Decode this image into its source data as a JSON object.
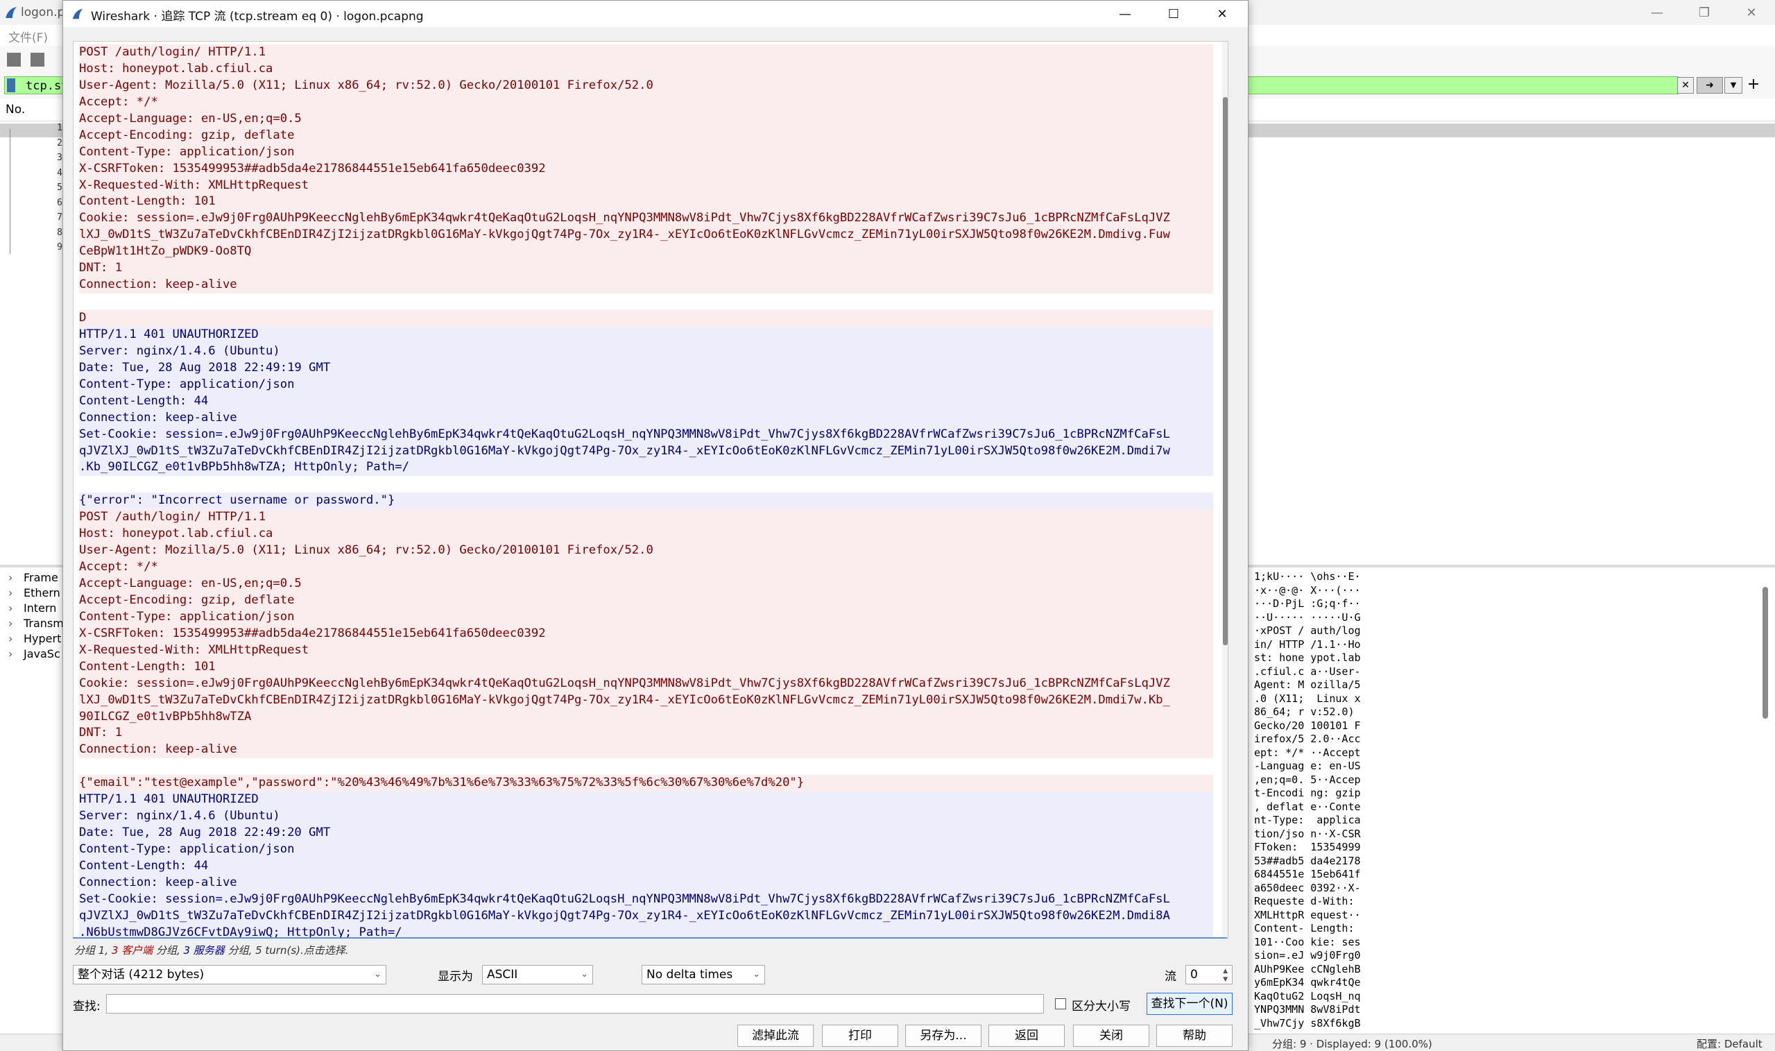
{
  "background_window": {
    "title": "logon.p",
    "menu": "文件(F)",
    "filter_value": "tcp.str",
    "column_no": "No.",
    "packet_numbers": [
      "1",
      "2",
      "3",
      "4",
      "5",
      "6",
      "7",
      "8",
      "9"
    ],
    "details": [
      "Frame",
      "Ethern",
      "Intern",
      "Transm",
      "Hypert",
      "JavaSc"
    ],
    "hex_lines": [
      "1;kU···· \\ohs··E·",
      "·x··@·@· X···(···",
      "···D·PjL :G;q·f··",
      "··U····· ·····U·G",
      "·xPOST / auth/log",
      "in/ HTTP /1.1··Ho",
      "st: hone ypot.lab",
      ".cfiul.c a··User-",
      "Agent: M ozilla/5",
      ".0 (X11;  Linux x",
      "86_64; r v:52.0)",
      "Gecko/20 100101 F",
      "irefox/5 2.0··Acc",
      "ept: */* ··Accept",
      "-Languag e: en-US",
      ",en;q=0. 5··Accep",
      "t-Encodi ng: gzip",
      ", deflat e··Conte",
      "nt-Type:  applica",
      "tion/jso n··X-CSR",
      "FToken:  15354999",
      "53##adb5 da4e2178",
      "6844551e 15eb641f",
      "a650deec 0392··X-",
      "Requeste d-With:",
      "XMLHttpR equest··",
      "Content- Length:",
      "101··Coo kie: ses",
      "sion=.eJ w9j0Frg0",
      "AUhP9Kee cCNglehB",
      "y6mEpK34 qwkr4tQe",
      "KaqOtuG2 LoqsH_nq",
      "YNPQ3MMN 8wV8iPdt",
      "_Vhw7Cjy s8Xf6kgB"
    ],
    "status_left": "分组: 9 · Displayed: 9 (100.0%)",
    "status_right": "配置: Default"
  },
  "dialog": {
    "title": "Wireshark · 追踪 TCP 流 (tcp.stream eq 0) · logon.pcapng",
    "stream_lines": [
      {
        "t": "POST /auth/login/ HTTP/1.1",
        "s": "cli"
      },
      {
        "t": "Host: honeypot.lab.cfiul.ca",
        "s": "cli"
      },
      {
        "t": "User-Agent: Mozilla/5.0 (X11; Linux x86_64; rv:52.0) Gecko/20100101 Firefox/52.0",
        "s": "cli"
      },
      {
        "t": "Accept: */*",
        "s": "cli"
      },
      {
        "t": "Accept-Language: en-US,en;q=0.5",
        "s": "cli"
      },
      {
        "t": "Accept-Encoding: gzip, deflate",
        "s": "cli"
      },
      {
        "t": "Content-Type: application/json",
        "s": "cli"
      },
      {
        "t": "X-CSRFToken: 1535499953##adb5da4e21786844551e15eb641fa650deec0392",
        "s": "cli"
      },
      {
        "t": "X-Requested-With: XMLHttpRequest",
        "s": "cli"
      },
      {
        "t": "Content-Length: 101",
        "s": "cli"
      },
      {
        "t": "Cookie: session=.eJw9j0Frg0AUhP9KeeccNglehBy6mEpK34qwkr4tQeKaqOtuG2LoqsH_nqYNPQ3MMN8wV8iPdt_Vhw7Cjys8Xf6kgBD228AVfrWCafZwsri39C7sJu6_1cBPRcNZMfCaFsLqJVZ",
        "s": "cli"
      },
      {
        "t": "lXJ_0wD1tS_tW3Zu7aTeDvCkhfCBEnDIR4ZjI2ijzatDRgkbl0G16MaY-kVkgojQgt74Pg-7Ox_zy1R4-_xEYIcOo6tEoK0zKlNFLGvVcmcz_ZEMin71yL00irSXJW5Qto98f0w26KE2M.Dmdivg.Fuw",
        "s": "cli"
      },
      {
        "t": "CeBpW1t1HtZo_pWDK9-Oo8TQ",
        "s": "cli"
      },
      {
        "t": "DNT: 1",
        "s": "cli"
      },
      {
        "t": "Connection: keep-alive",
        "s": "cli"
      },
      {
        "t": "",
        "s": "blank"
      },
      {
        "t": "D",
        "s": "cli"
      },
      {
        "t": "HTTP/1.1 401 UNAUTHORIZED",
        "s": "srv"
      },
      {
        "t": "Server: nginx/1.4.6 (Ubuntu)",
        "s": "srv"
      },
      {
        "t": "Date: Tue, 28 Aug 2018 22:49:19 GMT",
        "s": "srv"
      },
      {
        "t": "Content-Type: application/json",
        "s": "srv"
      },
      {
        "t": "Content-Length: 44",
        "s": "srv"
      },
      {
        "t": "Connection: keep-alive",
        "s": "srv"
      },
      {
        "t": "Set-Cookie: session=.eJw9j0Frg0AUhP9KeeccNglehBy6mEpK34qwkr4tQeKaqOtuG2LoqsH_nqYNPQ3MMN8wV8iPdt_Vhw7Cjys8Xf6kgBD228AVfrWCafZwsri39C7sJu6_1cBPRcNZMfCaFsL",
        "s": "srv"
      },
      {
        "t": "qJVZlXJ_0wD1tS_tW3Zu7aTeDvCkhfCBEnDIR4ZjI2ijzatDRgkbl0G16MaY-kVkgojQgt74Pg-7Ox_zy1R4-_xEYIcOo6tEoK0zKlNFLGvVcmcz_ZEMin71yL00irSXJW5Qto98f0w26KE2M.Dmdi7w",
        "s": "srv"
      },
      {
        "t": ".Kb_90ILCGZ_e0t1vBPb5hh8wTZA; HttpOnly; Path=/",
        "s": "srv"
      },
      {
        "t": "",
        "s": "blank"
      },
      {
        "t": "{\"error\": \"Incorrect username or password.\"}",
        "s": "srv"
      },
      {
        "t": "POST /auth/login/ HTTP/1.1",
        "s": "cli"
      },
      {
        "t": "Host: honeypot.lab.cfiul.ca",
        "s": "cli"
      },
      {
        "t": "User-Agent: Mozilla/5.0 (X11; Linux x86_64; rv:52.0) Gecko/20100101 Firefox/52.0",
        "s": "cli"
      },
      {
        "t": "Accept: */*",
        "s": "cli"
      },
      {
        "t": "Accept-Language: en-US,en;q=0.5",
        "s": "cli"
      },
      {
        "t": "Accept-Encoding: gzip, deflate",
        "s": "cli"
      },
      {
        "t": "Content-Type: application/json",
        "s": "cli"
      },
      {
        "t": "X-CSRFToken: 1535499953##adb5da4e21786844551e15eb641fa650deec0392",
        "s": "cli"
      },
      {
        "t": "X-Requested-With: XMLHttpRequest",
        "s": "cli"
      },
      {
        "t": "Content-Length: 101",
        "s": "cli"
      },
      {
        "t": "Cookie: session=.eJw9j0Frg0AUhP9KeeccNglehBy6mEpK34qwkr4tQeKaqOtuG2LoqsH_nqYNPQ3MMN8wV8iPdt_Vhw7Cjys8Xf6kgBD228AVfrWCafZwsri39C7sJu6_1cBPRcNZMfCaFsLqJVZ",
        "s": "cli"
      },
      {
        "t": "lXJ_0wD1tS_tW3Zu7aTeDvCkhfCBEnDIR4ZjI2ijzatDRgkbl0G16MaY-kVkgojQgt74Pg-7Ox_zy1R4-_xEYIcOo6tEoK0zKlNFLGvVcmcz_ZEMin71yL00irSXJW5Qto98f0w26KE2M.Dmdi7w.Kb_",
        "s": "cli"
      },
      {
        "t": "90ILCGZ_e0t1vBPb5hh8wTZA",
        "s": "cli"
      },
      {
        "t": "DNT: 1",
        "s": "cli"
      },
      {
        "t": "Connection: keep-alive",
        "s": "cli"
      },
      {
        "t": "",
        "s": "blank"
      },
      {
        "t": "{\"email\":\"test@example\",\"password\":\"%20%43%46%49%7b%31%6e%73%33%63%75%72%33%5f%6c%30%67%30%6e%7d%20\"}",
        "s": "cli"
      },
      {
        "t": "HTTP/1.1 401 UNAUTHORIZED",
        "s": "srv"
      },
      {
        "t": "Server: nginx/1.4.6 (Ubuntu)",
        "s": "srv"
      },
      {
        "t": "Date: Tue, 28 Aug 2018 22:49:20 GMT",
        "s": "srv"
      },
      {
        "t": "Content-Type: application/json",
        "s": "srv"
      },
      {
        "t": "Content-Length: 44",
        "s": "srv"
      },
      {
        "t": "Connection: keep-alive",
        "s": "srv"
      },
      {
        "t": "Set-Cookie: session=.eJw9j0Frg0AUhP9KeeccNglehBy6mEpK34qwkr4tQeKaqOtuG2LoqsH_nqYNPQ3MMN8wV8iPdt_Vhw7Cjys8Xf6kgBD228AVfrWCafZwsri39C7sJu6_1cBPRcNZMfCaFsL",
        "s": "srv"
      },
      {
        "t": "qJVZlXJ_0wD1tS_tW3Zu7aTeDvCkhfCBEnDIR4ZjI2ijzatDRgkbl0G16MaY-kVkgojQgt74Pg-7Ox_zy1R4-_xEYIcOo6tEoK0zKlNFLGvVcmcz_ZEMin71yL00irSXJW5Qto98f0w26KE2M.Dmdi8A",
        "s": "srv"
      },
      {
        "t": ".N6bUstmwD8GJVz6CFvtDAy9iwQ; HttpOnly; Path=/",
        "s": "srv"
      }
    ],
    "summary_a": "分组 1, ",
    "summary_client": "3 客户端",
    "summary_b": " 分组, ",
    "summary_server": "3 服务器",
    "summary_c": " 分组, 5 turn(s).点击选择.",
    "conversation_select": "整个对话 (4212 bytes)",
    "show_as_label": "显示为",
    "show_as_select": "ASCII",
    "delta_select": "No delta times",
    "stream_label": "流",
    "stream_value": "0",
    "find_label": "查找:",
    "find_value": "",
    "case_label": "区分大小写",
    "find_next": "查找下一个(N)",
    "buttons": {
      "filter_out": "滤掉此流",
      "print": "打印",
      "save_as": "另存为...",
      "back": "返回",
      "close": "关闭",
      "help": "帮助"
    },
    "colors": {
      "client_text": "#7f0000",
      "client_bg": "#fbeded",
      "server_text": "#00007f",
      "server_bg": "#ededfb",
      "accent": "#2f6fd6"
    }
  }
}
